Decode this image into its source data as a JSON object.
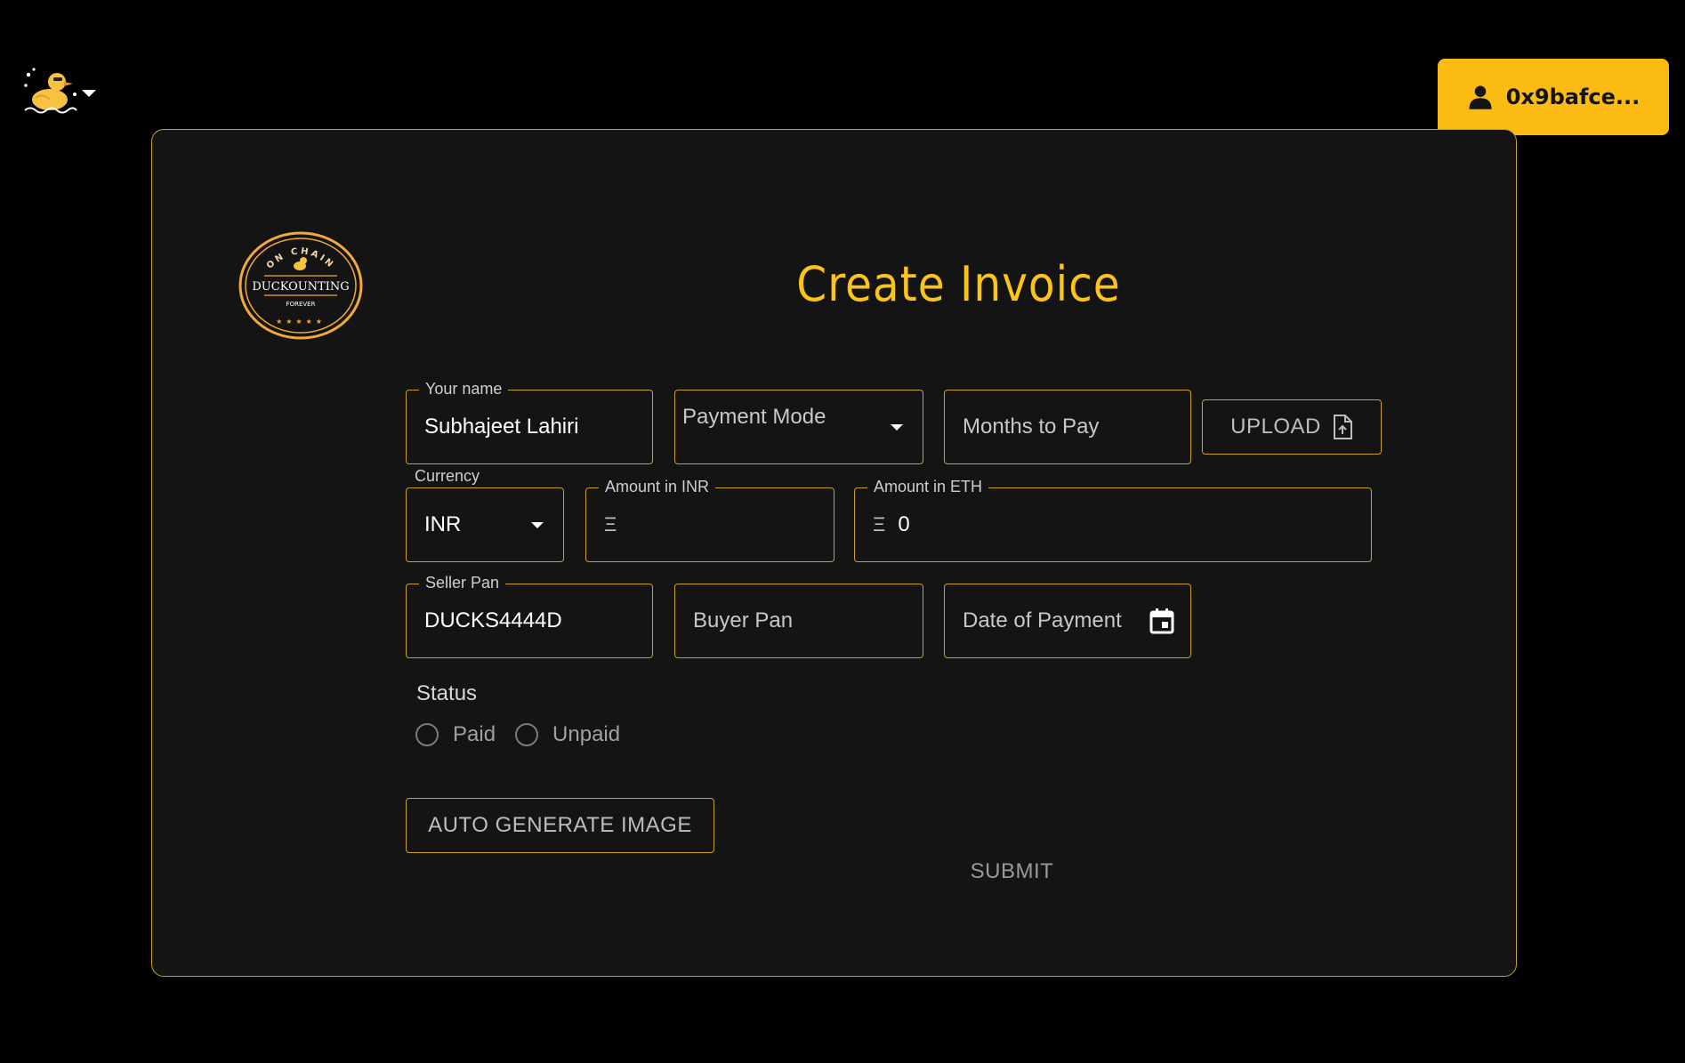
{
  "header": {
    "wallet_address": "0x9bafce..."
  },
  "card": {
    "seal": {
      "top_text": "ON CHAIN",
      "main_text": "DUCKOUNTING",
      "bottom_text": "FOREVER"
    },
    "title": "Create Invoice"
  },
  "form": {
    "your_name": {
      "label": "Your name",
      "value": "Subhajeet Lahiri"
    },
    "payment_mode": {
      "placeholder": "Payment Mode"
    },
    "months_to_pay": {
      "placeholder": "Months to Pay"
    },
    "upload_label": "UPLOAD",
    "currency": {
      "label": "Currency",
      "value": "INR"
    },
    "amount_inr": {
      "label": "Amount in INR",
      "prefix": "Ξ",
      "value": ""
    },
    "amount_eth": {
      "label": "Amount in ETH",
      "prefix": "Ξ",
      "value": "0"
    },
    "seller_pan": {
      "label": "Seller Pan",
      "value": "DUCKS4444D"
    },
    "buyer_pan": {
      "placeholder": "Buyer Pan"
    },
    "date_of_payment": {
      "placeholder": "Date of Payment"
    },
    "status": {
      "label": "Status",
      "options": [
        "Paid",
        "Unpaid"
      ]
    },
    "auto_generate_label": "AUTO GENERATE IMAGE",
    "submit_label": "SUBMIT"
  },
  "colors": {
    "accent": "#fcc419",
    "wallet_button": "#fcbb12",
    "card_background": "#141414",
    "border": "#c9a227"
  }
}
